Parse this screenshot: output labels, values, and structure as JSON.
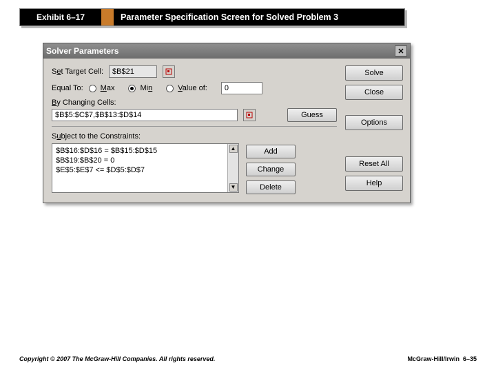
{
  "banner": {
    "tab": "Exhibit 6–17",
    "title": "Parameter Specification Screen for Solved Problem 3"
  },
  "dialog": {
    "title": "Solver Parameters",
    "target_label": "Set Target Cell:",
    "target_value": "$B$21",
    "equal_label": "Equal To:",
    "radios": {
      "max": "Max",
      "min": "Min",
      "valueof": "Value of:"
    },
    "valueof_value": "0",
    "changing_label": "By Changing Cells:",
    "changing_value": "$B$5:$C$7,$B$13:$D$14",
    "constraints_label": "Subject to the Constraints:",
    "constraints": [
      "$B$16:$D$16 = $B$15:$D$15",
      "$B$19:$B$20 = 0",
      "$E$5:$E$7 <= $D$5:$D$7"
    ],
    "buttons": {
      "solve": "Solve",
      "close": "Close",
      "options": "Options",
      "resetall": "Reset All",
      "help": "Help",
      "guess": "Guess",
      "add": "Add",
      "change": "Change",
      "delete": "Delete"
    }
  },
  "footer": {
    "left": "Copyright © 2007 The McGraw-Hill Companies. All rights reserved.",
    "right": "McGraw-Hill/Irwin",
    "page": "6–35"
  }
}
